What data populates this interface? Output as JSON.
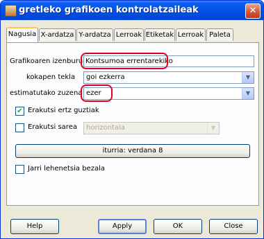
{
  "window": {
    "title": "gretleko grafikoen kontrolatzaileak",
    "close_label": "✕"
  },
  "tabs": [
    {
      "label": "Nagusia",
      "active": true
    },
    {
      "label": "X-ardatza"
    },
    {
      "label": "Y-ardatza"
    },
    {
      "label": "Lerroak"
    },
    {
      "label": "Etiketak"
    },
    {
      "label": "Lerroak"
    },
    {
      "label": "Paleta"
    }
  ],
  "form": {
    "graph_title_label": "Grafikoaren izenburua",
    "graph_title_value": "Kontsumoa errentarekiko",
    "key_position_label": "kokapen tekla",
    "key_position_value": "goi ezkerra",
    "fitted_line_label": "estimatutako zuzena",
    "fitted_line_value": "ezer",
    "show_all_borders_label": "Erakutsi ertz guztiak",
    "show_all_borders_checked": true,
    "show_grid_label": "Erakutsi sarea",
    "show_grid_checked": false,
    "grid_orientation_value": "horizontala",
    "font_button_label": "iturria: verdana 8",
    "set_default_label": "Jarri lehenetsia bezala",
    "set_default_checked": false
  },
  "buttons": {
    "help": "Help",
    "apply": "Apply",
    "ok": "OK",
    "close": "Close"
  },
  "colors": {
    "title_bar": "#0050e6",
    "highlight": "#e0001b",
    "dialog_bg": "#ece9d8"
  }
}
